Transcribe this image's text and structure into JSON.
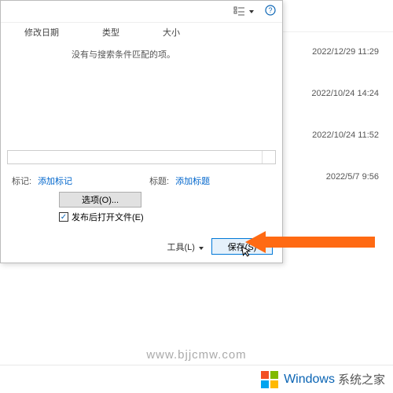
{
  "background": {
    "dates": [
      "2022/12/29 11:29",
      "2022/10/24 14:24",
      "2022/10/24 11:52",
      "2022/5/7 9:56"
    ]
  },
  "dialog": {
    "headers": {
      "date": "修改日期",
      "type": "类型",
      "size": "大小"
    },
    "empty": "没有与搜索条件匹配的项。",
    "fields": {
      "tag_label": "标记:",
      "tag_link": "添加标记",
      "title_label": "标题:",
      "title_link": "添加标题"
    },
    "options_btn": "选项(O)...",
    "checkbox": "发布后打开文件(E)",
    "tools": "工具(L)",
    "save": "保存(S)"
  },
  "watermark": "www.bjjcmw.com",
  "footer": {
    "brand": "Windows",
    "sub": "系统之家"
  }
}
